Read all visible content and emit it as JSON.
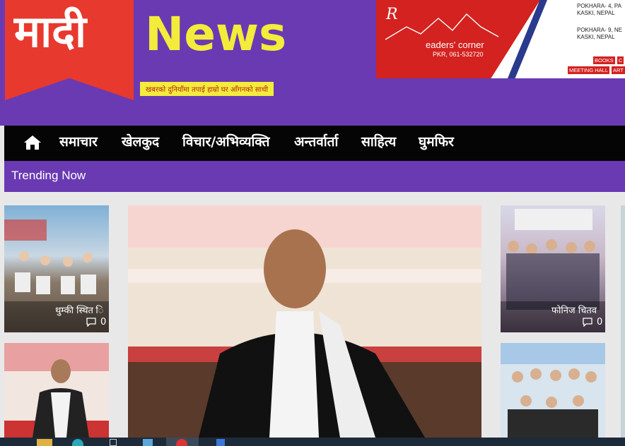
{
  "brand": {
    "logo": "मादी",
    "news": "News",
    "tagline": "खबरको दुनियाँमा तपाई हाम्रो घर आँगनको साथी"
  },
  "ad": {
    "logo": "R",
    "name": "eaders' corner",
    "phone": "PKR, 061-532720",
    "address1": [
      "POKHARA- 4, PA",
      "KASKI, NEPAL"
    ],
    "address2": [
      "POKHARA- 9, NE",
      "KASKI, NEPAL"
    ],
    "tags": [
      "BOOKS",
      "C",
      "MEETING HALL",
      "ART"
    ]
  },
  "nav": {
    "items": [
      "समाचार",
      "खेलकुद",
      "विचार/अभिव्यक्ति",
      "अन्तर्वार्ता",
      "साहित्य",
      "घुमफिर"
    ]
  },
  "trending": {
    "label": "Trending Now"
  },
  "cards": [
    {
      "title": "थुम्की स्थित ि",
      "comments": "0"
    },
    {
      "title": "फोनिज चितव",
      "comments": "0"
    }
  ],
  "colors": {
    "purple": "#6a3ab2",
    "red": "#e8392e",
    "yellow": "#f3ec3a"
  }
}
